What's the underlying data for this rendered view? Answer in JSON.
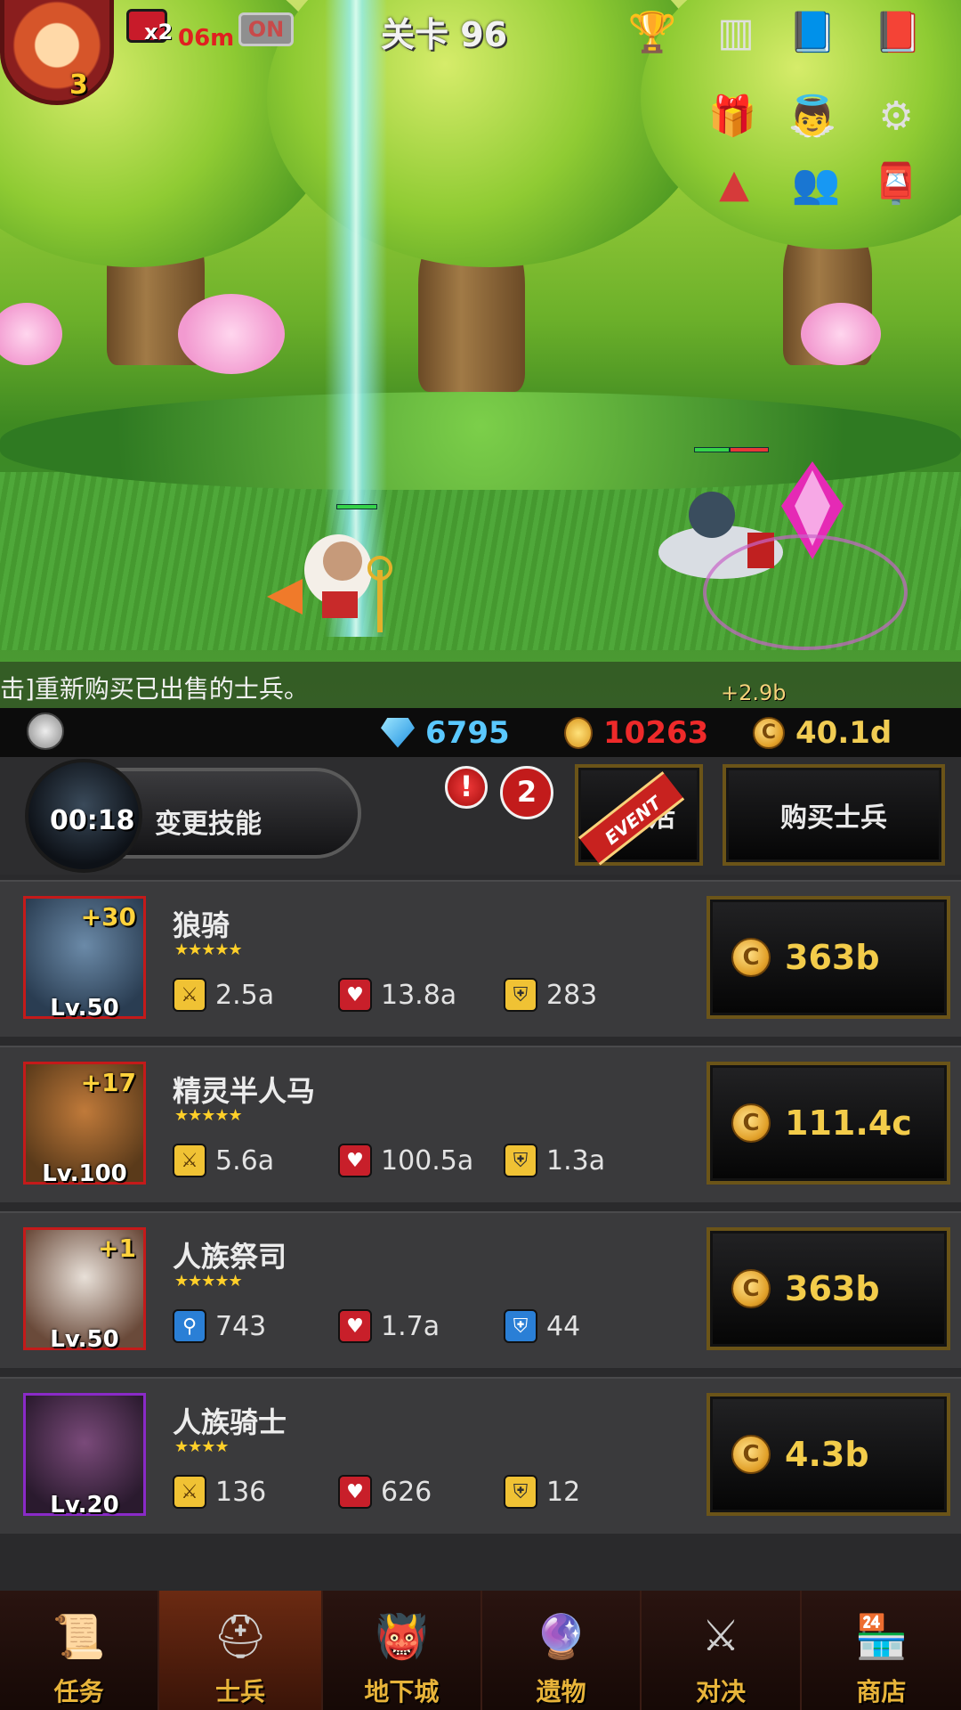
{
  "hud": {
    "hero_level": "3",
    "speed_multiplier": "x2",
    "speed_time": "06m",
    "toggle_label": "ON",
    "stage_title": "关卡 96",
    "icons": [
      "trophy-icon",
      "ranking-icon",
      "codex-icon",
      "quest-book-icon",
      "treasure-chest-icon",
      "angel-icon",
      "settings-icon",
      "warning-icon",
      "friends-icon",
      "mailbox-icon"
    ]
  },
  "notice": {
    "text": "击]重新购买已出售的士兵。",
    "gain": "+2.9b"
  },
  "currency": {
    "gems": "6795",
    "medals": "10263",
    "gold": "40.1d"
  },
  "actions": {
    "skill_timer": "00:18",
    "skill_label": "变更技能",
    "alert": "!",
    "badge_count": "2",
    "event_ribbon": "EVENT",
    "revive_label": "复活",
    "buy_soldier_label": "购买士兵"
  },
  "soldiers": [
    {
      "name": "狼骑",
      "bonus": "+30",
      "level": "Lv.50",
      "stars": "★★★★★",
      "stat1": "2.5a",
      "stat1_icon": "sword-icon",
      "stat2": "13.8a",
      "stat2_icon": "heart-icon",
      "stat3": "283",
      "stat3_icon": "shield-icon",
      "price": "363b"
    },
    {
      "name": "精灵半人马",
      "bonus": "+17",
      "level": "Lv.100",
      "stars": "★★★★★",
      "stat1": "5.6a",
      "stat1_icon": "sword-icon",
      "stat2": "100.5a",
      "stat2_icon": "heart-icon",
      "stat3": "1.3a",
      "stat3_icon": "shield-icon",
      "price": "111.4c"
    },
    {
      "name": "人族祭司",
      "bonus": "+1",
      "level": "Lv.50",
      "stars": "★★★★★",
      "stat1": "743",
      "stat1_icon": "magic-staff-icon",
      "stat2": "1.7a",
      "stat2_icon": "heart-icon",
      "stat3": "44",
      "stat3_icon": "magic-shield-icon",
      "price": "363b"
    },
    {
      "name": "人族骑士",
      "bonus": "",
      "level": "Lv.20",
      "stars": "★★★★",
      "stat1": "136",
      "stat1_icon": "sword-icon",
      "stat2": "626",
      "stat2_icon": "heart-icon",
      "stat3": "12",
      "stat3_icon": "shield-icon",
      "price": "4.3b"
    }
  ],
  "nav": [
    {
      "label": "任务",
      "icon": "scroll-icon"
    },
    {
      "label": "士兵",
      "icon": "helmet-icon"
    },
    {
      "label": "地下城",
      "icon": "monster-icon"
    },
    {
      "label": "遗物",
      "icon": "orb-icon"
    },
    {
      "label": "对决",
      "icon": "crossed-swords-icon"
    },
    {
      "label": "商店",
      "icon": "shop-icon"
    }
  ]
}
